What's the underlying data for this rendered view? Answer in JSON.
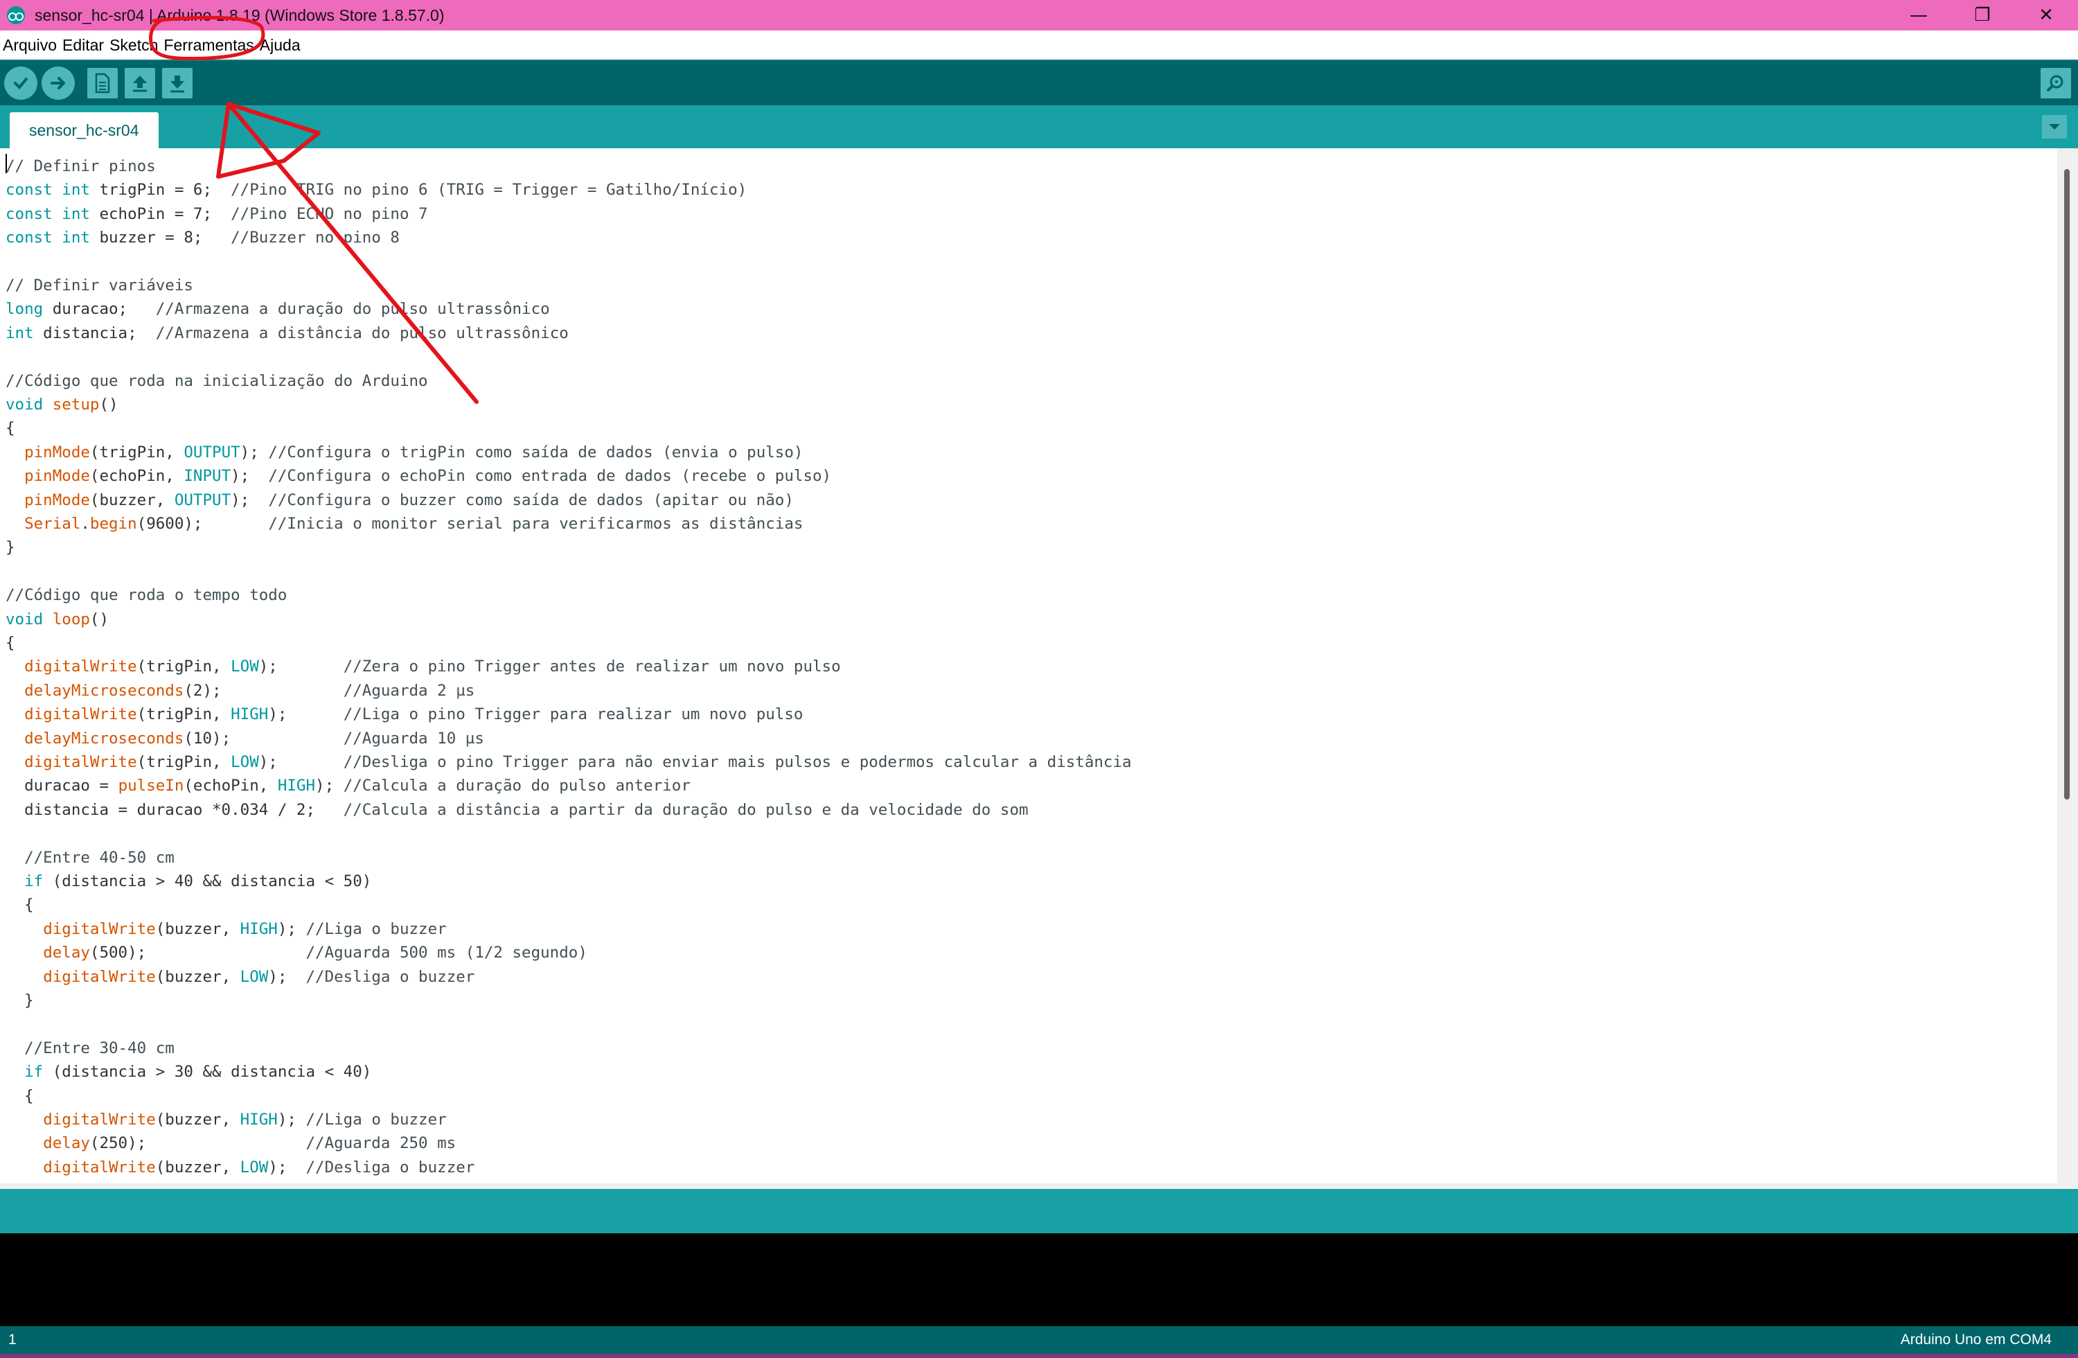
{
  "window": {
    "title": "sensor_hc-sr04 | Arduino 1.8.19 (Windows Store 1.8.57.0)",
    "controls": {
      "minimize": "—",
      "restore": "❐",
      "close": "✕"
    }
  },
  "menu": {
    "items": [
      "Arquivo",
      "Editar",
      "Sketch",
      "Ferramentas",
      "Ajuda"
    ]
  },
  "toolbar": {
    "buttons": [
      "check-icon",
      "arrow-right-icon",
      "new-file-icon",
      "arrow-up-icon",
      "arrow-down-icon"
    ],
    "serial_monitor_icon": "magnifier-icon"
  },
  "tabs": [
    {
      "label": "sensor_hc-sr04"
    }
  ],
  "editor": {
    "lines": [
      "// Definir pinos",
      "const int trigPin = 6;  //Pino TRIG no pino 6 (TRIG = Trigger = Gatilho/Início)",
      "const int echoPin = 7;  //Pino ECHO no pino 7",
      "const int buzzer = 8;   //Buzzer no pino 8",
      "",
      "// Definir variáveis",
      "long duracao;   //Armazena a duração do pulso ultrassônico",
      "int distancia;  //Armazena a distância do pulso ultrassônico",
      "",
      "//Código que roda na inicialização do Arduino",
      "void setup()",
      "{",
      "  pinMode(trigPin, OUTPUT); //Configura o trigPin como saída de dados (envia o pulso)",
      "  pinMode(echoPin, INPUT);  //Configura o echoPin como entrada de dados (recebe o pulso)",
      "  pinMode(buzzer, OUTPUT);  //Configura o buzzer como saída de dados (apitar ou não)",
      "  Serial.begin(9600);       //Inicia o monitor serial para verificarmos as distâncias",
      "}",
      "",
      "//Código que roda o tempo todo",
      "void loop()",
      "{",
      "  digitalWrite(trigPin, LOW);       //Zera o pino Trigger antes de realizar um novo pulso",
      "  delayMicroseconds(2);             //Aguarda 2 µs",
      "  digitalWrite(trigPin, HIGH);      //Liga o pino Trigger para realizar um novo pulso",
      "  delayMicroseconds(10);            //Aguarda 10 µs",
      "  digitalWrite(trigPin, LOW);       //Desliga o pino Trigger para não enviar mais pulsos e podermos calcular a distância",
      "  duracao = pulseIn(echoPin, HIGH); //Calcula a duração do pulso anterior",
      "  distancia = duracao *0.034 / 2;   //Calcula a distância a partir da duração do pulso e da velocidade do som",
      "",
      "  //Entre 40-50 cm",
      "  if (distancia > 40 && distancia < 50)",
      "  {",
      "    digitalWrite(buzzer, HIGH); //Liga o buzzer",
      "    delay(500);                 //Aguarda 500 ms (1/2 segundo)",
      "    digitalWrite(buzzer, LOW);  //Desliga o buzzer",
      "  }",
      "",
      "  //Entre 30-40 cm",
      "  if (distancia > 30 && distancia < 40)",
      "  {",
      "    digitalWrite(buzzer, HIGH); //Liga o buzzer",
      "    delay(250);                 //Aguarda 250 ms",
      "    digitalWrite(buzzer, LOW);  //Desliga o buzzer",
      "  }"
    ]
  },
  "status": {
    "line_number": "1",
    "board": "Arduino Uno em COM4"
  },
  "colors": {
    "titlebar": "#ee6abd",
    "toolbar": "#006468",
    "tabstrip": "#17a1a5",
    "keyword": "#00979c",
    "function": "#d35400",
    "annotation": "#e3141b"
  }
}
